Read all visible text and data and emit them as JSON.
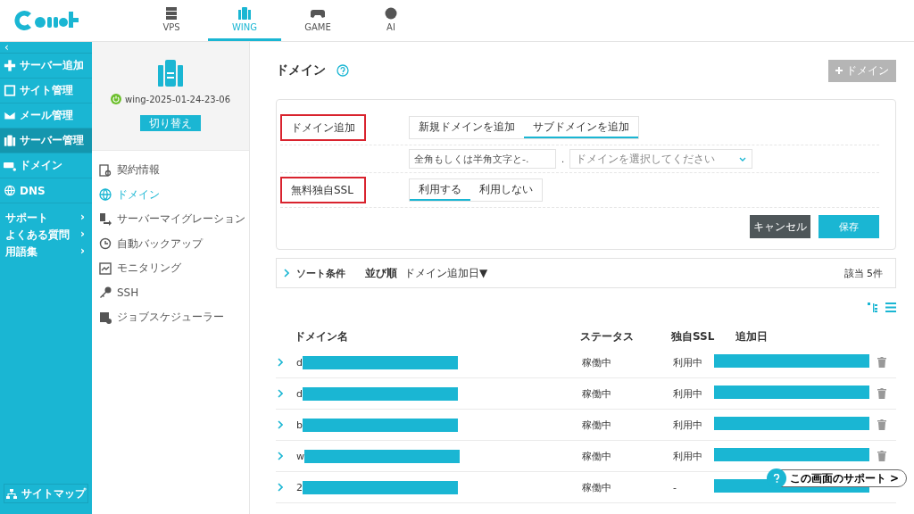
{
  "header": {
    "tabs": [
      {
        "label": "VPS",
        "selected": false
      },
      {
        "label": "WING",
        "selected": true
      },
      {
        "label": "GAME",
        "selected": false
      },
      {
        "label": "AI",
        "selected": false
      }
    ]
  },
  "sidebar": {
    "collapse": "‹",
    "items": [
      {
        "label": "サーバー追加",
        "selected": false
      },
      {
        "label": "サイト管理",
        "selected": false
      },
      {
        "label": "メール管理",
        "selected": false
      },
      {
        "label": "サーバー管理",
        "selected": true
      },
      {
        "label": "ドメイン",
        "selected": false
      },
      {
        "label": "DNS",
        "selected": false
      }
    ],
    "links": [
      {
        "label": "サポート",
        "chevron": "›"
      },
      {
        "label": "よくある質問",
        "chevron": "›"
      },
      {
        "label": "用語集",
        "chevron": "›"
      }
    ],
    "sitemap": "サイトマップ"
  },
  "server_panel": {
    "name": "wing-2025-01-24-23-06",
    "running": true,
    "switch_button": "切り替え",
    "menu": [
      {
        "label": "契約情報",
        "selected": false
      },
      {
        "label": "ドメイン",
        "selected": true
      },
      {
        "label": "サーバーマイグレーション",
        "selected": false
      },
      {
        "label": "自動バックアップ",
        "selected": false
      },
      {
        "label": "モニタリング",
        "selected": false
      },
      {
        "label": "SSH",
        "selected": false
      },
      {
        "label": "ジョブスケジューラー",
        "selected": false
      }
    ]
  },
  "main": {
    "title": "ドメイン",
    "add_button": {
      "label": "ドメイン",
      "disabled": true
    },
    "form": {
      "domain_label": {
        "text": "ドメイン追加",
        "highlighted": true
      },
      "domain_tabs": [
        {
          "label": "新規ドメインを追加",
          "selected": false
        },
        {
          "label": "サブドメインを追加",
          "selected": true
        }
      ],
      "sub_input": {
        "placeholder": "全角もしくは半角文字と-."
      },
      "separator": ".",
      "domain_select": {
        "placeholder": "ドメインを選択してください"
      },
      "ssl_label": {
        "text": "無料独自SSL",
        "highlighted": true
      },
      "ssl_options": [
        {
          "label": "利用する",
          "selected": true
        },
        {
          "label": "利用しない",
          "selected": false
        }
      ],
      "cancel": "キャンセル",
      "save": "保存"
    },
    "sort": {
      "label": "ソート条件",
      "order_label": "並び順",
      "order_value": "ドメイン追加日▼",
      "count": "該当 5件"
    },
    "table": {
      "columns": [
        "ドメイン名",
        "ステータス",
        "独自SSL",
        "追加日"
      ],
      "rows": [
        {
          "domain": "d",
          "status": "稼働中",
          "ssl": "利用中",
          "deletable": true
        },
        {
          "domain": "d",
          "status": "稼働中",
          "ssl": "利用中",
          "deletable": true
        },
        {
          "domain": "b",
          "status": "稼働中",
          "ssl": "利用中",
          "deletable": true
        },
        {
          "domain": "w",
          "status": "稼働中",
          "ssl": "利用中",
          "deletable": true
        },
        {
          "domain": "2",
          "status": "稼働中",
          "ssl": "-",
          "deletable": false
        }
      ]
    },
    "support_button": "この画面のサポート >"
  }
}
